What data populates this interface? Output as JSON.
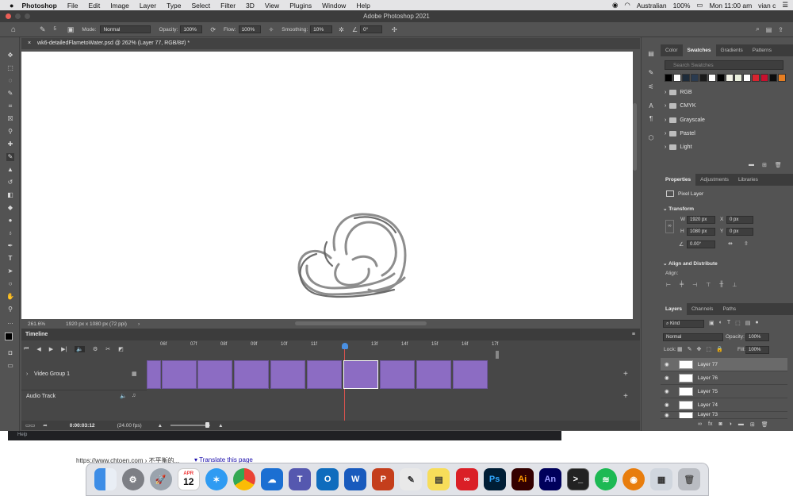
{
  "menubar": {
    "apple": "",
    "app": "Photoshop",
    "items": [
      "File",
      "Edit",
      "Image",
      "Layer",
      "Type",
      "Select",
      "Filter",
      "3D",
      "View",
      "Plugins",
      "Window",
      "Help"
    ],
    "input_source": "Australian",
    "battery": "100%",
    "clock": "Mon 11:00 am",
    "user": "vian c"
  },
  "window": {
    "title": "Adobe Photoshop 2021"
  },
  "options": {
    "brush_size": "5",
    "mode_label": "Mode:",
    "mode_value": "Normal",
    "opacity_label": "Opacity:",
    "opacity_value": "100%",
    "flow_label": "Flow:",
    "flow_value": "100%",
    "smoothing_label": "Smoothing:",
    "smoothing_value": "10%",
    "angle_value": "0°"
  },
  "document": {
    "tab_title": "wk6-detailedFlametoWater.psd @ 262% (Layer 77, RGB/8#) *",
    "zoom": "261.6%",
    "dimensions": "1920 px x 1080 px (72 ppi)"
  },
  "timeline": {
    "title": "Timeline",
    "ticks": [
      "06f",
      "07f",
      "08f",
      "09f",
      "10f",
      "11f",
      "13f",
      "14f",
      "15f",
      "16f",
      "17f"
    ],
    "track_video": "Video Group 1",
    "track_audio": "Audio Track",
    "timecode": "0:00:03:12",
    "fps": "(24.00 fps)"
  },
  "swatches_panel": {
    "tabs": [
      "Color",
      "Swatches",
      "Gradients",
      "Patterns"
    ],
    "active_tab": "Swatches",
    "search_placeholder": "Search Swatches",
    "colors": [
      "#000000",
      "#ffffff",
      "#1d2b3a",
      "#2a3b50",
      "#1a1a1a",
      "#ffffff",
      "#000000",
      "#f2f2e6",
      "#e9eedc",
      "#ffffff",
      "#d9242f",
      "#c8102e",
      "#0c0c0c",
      "#e67e22"
    ],
    "folders": [
      "RGB",
      "CMYK",
      "Grayscale",
      "Pastel",
      "Light"
    ]
  },
  "properties_panel": {
    "tabs": [
      "Properties",
      "Adjustments",
      "Libraries"
    ],
    "active_tab": "Properties",
    "kind": "Pixel Layer",
    "transform_label": "Transform",
    "w_label": "W",
    "w_value": "1920 px",
    "x_label": "X",
    "x_value": "0 px",
    "h_label": "H",
    "h_value": "1080 px",
    "y_label": "Y",
    "y_value": "0 px",
    "angle_value": "0.00°",
    "align_label": "Align and Distribute",
    "align_sub": "Align:"
  },
  "layers_panel": {
    "tabs": [
      "Layers",
      "Channels",
      "Paths"
    ],
    "active_tab": "Layers",
    "filter": "Kind",
    "blend_mode": "Normal",
    "opacity_label": "Opacity:",
    "opacity_value": "100%",
    "lock_label": "Lock:",
    "fill_label": "Fill:",
    "fill_value": "100%",
    "layers": [
      "Layer 77",
      "Layer 76",
      "Layer 75",
      "Layer 74",
      "Layer 73"
    ]
  },
  "background": {
    "help_tab": "Help",
    "url": "https://www.chtoen.com › 不平衡的...",
    "translate": "Translate this page"
  },
  "dock": {
    "calendar_month": "APR",
    "calendar_day": "12",
    "apps": [
      "Finder",
      "System Preferences",
      "Launchpad",
      "Calendar",
      "Safari",
      "Chrome",
      "OneDrive",
      "Teams",
      "Outlook",
      "Word",
      "PowerPoint",
      "TextEdit",
      "Notes",
      "Creative Cloud",
      "Photoshop",
      "Illustrator",
      "Animate",
      "Terminal",
      "Spotify",
      "Blender",
      "Preview",
      "Trash"
    ],
    "ps_label": "Ps",
    "ai_label": "Ai",
    "an_label": "An"
  }
}
